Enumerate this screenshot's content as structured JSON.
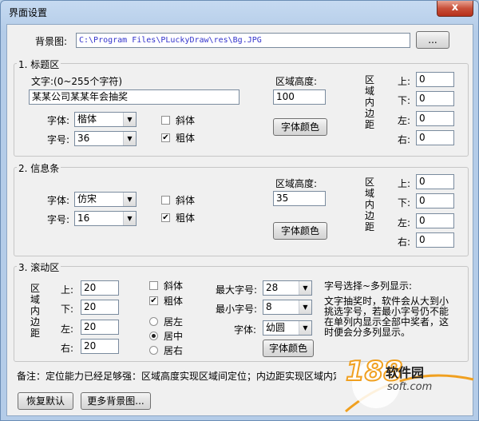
{
  "window": {
    "title": "界面设置",
    "close": "x"
  },
  "background": {
    "label": "背景图:",
    "path": "C:\\Program Files\\PLuckyDraw\\res\\Bg.JPG",
    "browse_label": "..."
  },
  "title_area": {
    "legend": "1. 标题区",
    "text_label": "文字:(0~255个字符)",
    "text_value": "某某公司某某年会抽奖",
    "height_label": "区域高度:",
    "height_value": "100",
    "font_label": "字体:",
    "font_value": "楷体",
    "size_label": "字号:",
    "size_value": "36",
    "italic_label": "斜体",
    "bold_label": "粗体",
    "italic_checked": false,
    "bold_checked": true,
    "color_button": "字体颜色",
    "padding_label": "区域内边距",
    "top_label": "上:",
    "top_value": "0",
    "bottom_label": "下:",
    "bottom_value": "0",
    "left_label": "左:",
    "left_value": "0",
    "right_label": "右:",
    "right_value": "0"
  },
  "info_bar": {
    "legend": "2. 信息条",
    "height_label": "区域高度:",
    "height_value": "35",
    "font_label": "字体:",
    "font_value": "仿宋",
    "size_label": "字号:",
    "size_value": "16",
    "italic_label": "斜体",
    "bold_label": "粗体",
    "italic_checked": false,
    "bold_checked": true,
    "color_button": "字体颜色",
    "padding_label": "区域内边距",
    "top_label": "上:",
    "top_value": "0",
    "bottom_label": "下:",
    "bottom_value": "0",
    "left_label": "左:",
    "left_value": "0",
    "right_label": "右:",
    "right_value": "0"
  },
  "scroll_area": {
    "legend": "3. 滚动区",
    "padding_label": "区域内边距",
    "top_label": "上:",
    "top_value": "20",
    "bottom_label": "下:",
    "bottom_value": "20",
    "left_label": "左:",
    "left_value": "20",
    "right_label": "右:",
    "right_value": "20",
    "italic_label": "斜体",
    "bold_label": "粗体",
    "italic_checked": false,
    "bold_checked": true,
    "align_left": "居左",
    "align_center": "居中",
    "align_right": "居右",
    "align_selected": "居中",
    "max_size_label": "最大字号:",
    "max_size_value": "28",
    "min_size_label": "最小字号:",
    "min_size_value": "8",
    "font_label": "字体:",
    "font_value": "幼圆",
    "color_button": "字体颜色",
    "hint_title": "字号选择~多列显示:",
    "hint_body": "文字抽奖时，软件会从大到小挑选字号，若最小字号仍不能在单列内显示全部中奖者，这时便会分多列显示。"
  },
  "note": "备注：定位能力已经足够强：区域高度实现区域间定位；内边距实现区域内定位；",
  "buttons": {
    "restore": "恢复默认",
    "more_bg": "更多背景图..."
  },
  "watermark": {
    "number": "188",
    "name": "软件园",
    "url": "soft.com"
  }
}
